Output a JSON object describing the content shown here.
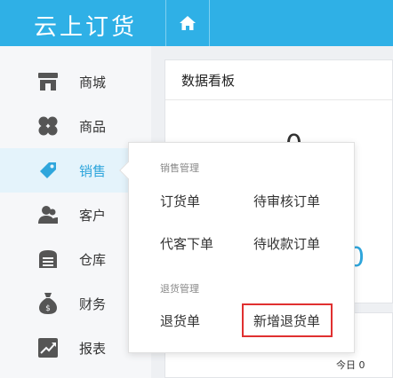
{
  "app": {
    "title": "云上订货"
  },
  "sidebar": {
    "items": [
      {
        "label": "商城",
        "icon": "store-icon"
      },
      {
        "label": "商品",
        "icon": "goods-icon"
      },
      {
        "label": "销售",
        "icon": "tag-icon"
      },
      {
        "label": "客户",
        "icon": "customer-icon"
      },
      {
        "label": "仓库",
        "icon": "warehouse-icon"
      },
      {
        "label": "财务",
        "icon": "money-bag-icon"
      },
      {
        "label": "报表",
        "icon": "chart-icon"
      }
    ]
  },
  "dashboard": {
    "title": "数据看板",
    "value1": "0",
    "value2": "0",
    "today_label": "今日 0"
  },
  "sales_menu": {
    "section1_title": "销售管理",
    "section1_items": [
      "订货单",
      "待审核订单",
      "代客下单",
      "待收款订单"
    ],
    "section2_title": "退货管理",
    "section2_items": [
      "退货单",
      "新增退货单"
    ]
  },
  "colors": {
    "brand": "#2fb0e6",
    "active": "#2fa6dc",
    "highlight": "#e03030"
  }
}
